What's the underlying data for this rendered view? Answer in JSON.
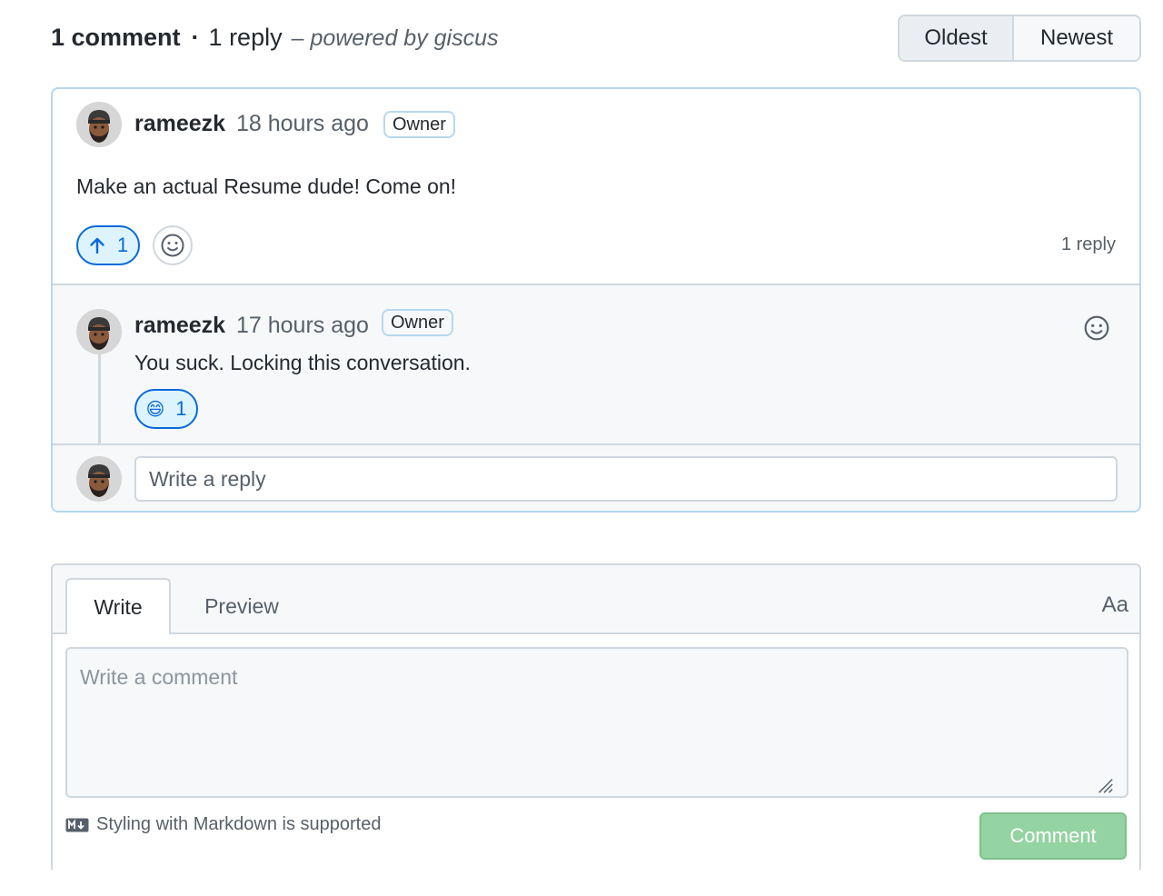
{
  "header": {
    "comment_count": "1 comment",
    "separator": "·",
    "reply_count": "1 reply",
    "powered_by": "– powered by giscus",
    "sort_options": [
      "Oldest",
      "Newest"
    ],
    "sort_selected": "Oldest"
  },
  "thread": {
    "comment": {
      "author": "rameezk",
      "time": "18 hours ago",
      "badge": "Owner",
      "body": "Make an actual Resume dude! Come on!",
      "upvote_count": "1",
      "reply_count_label": "1 reply"
    },
    "reply": {
      "author": "rameezk",
      "time": "17 hours ago",
      "badge": "Owner",
      "body": "You suck. Locking this conversation.",
      "reaction_emoji": "😄",
      "reaction_count": "1"
    },
    "reply_placeholder": "Write a reply"
  },
  "composer": {
    "tabs": [
      "Write",
      "Preview"
    ],
    "active_tab": "Write",
    "format_toggle": "Aa",
    "placeholder": "Write a comment",
    "markdown_note": "Styling with Markdown is supported",
    "submit_label": "Comment"
  },
  "colors": {
    "accent_blue": "#0969da",
    "thread_border": "#b6d8ee",
    "comment_button_disabled": "#94d3a2"
  }
}
